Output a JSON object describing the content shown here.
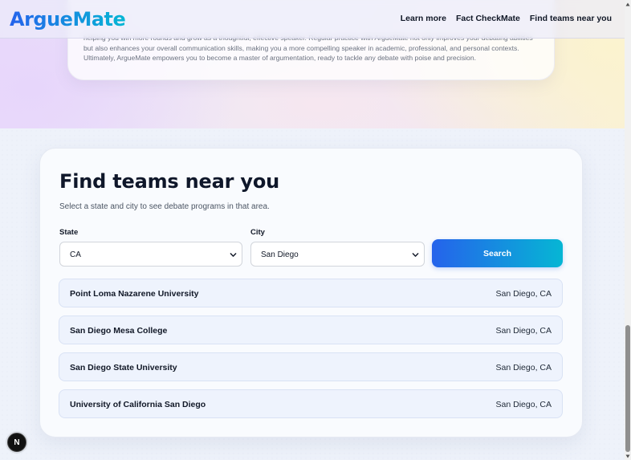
{
  "brand": {
    "name": "ArgueMate"
  },
  "nav": {
    "links": [
      "Learn more",
      "Fact CheckMate",
      "Find teams near you"
    ]
  },
  "intro": {
    "text_partial": "helping you win more rounds and grow as a thoughtful, effective speaker. Regular practice with ArgueMate not only improves your debating abilities but also enhances your overall communication skills, making you a more compelling speaker in academic, professional, and personal contexts. Ultimately, ArgueMate empowers you to become a master of argumentation, ready to tackle any debate with poise and precision."
  },
  "finder": {
    "title": "Find teams near you",
    "subtitle": "Select a state and city to see debate programs in that area.",
    "state_label": "State",
    "state_value": "CA",
    "city_label": "City",
    "city_value": "San Diego",
    "search_label": "Search",
    "results": [
      {
        "name": "Point Loma Nazarene University",
        "location": "San Diego, CA"
      },
      {
        "name": "San Diego Mesa College",
        "location": "San Diego, CA"
      },
      {
        "name": "San Diego State University",
        "location": "San Diego, CA"
      },
      {
        "name": "University of California San Diego",
        "location": "San Diego, CA"
      }
    ]
  },
  "dev_badge": {
    "label": "N"
  },
  "colors": {
    "accent_start": "#2563eb",
    "accent_end": "#06b6d4",
    "result_bg": "#eef3fd"
  },
  "icons": {
    "select_chevron": "chevron-down-icon",
    "scroll_up": "scroll-up-arrow-icon",
    "scroll_down": "scroll-down-arrow-icon"
  }
}
